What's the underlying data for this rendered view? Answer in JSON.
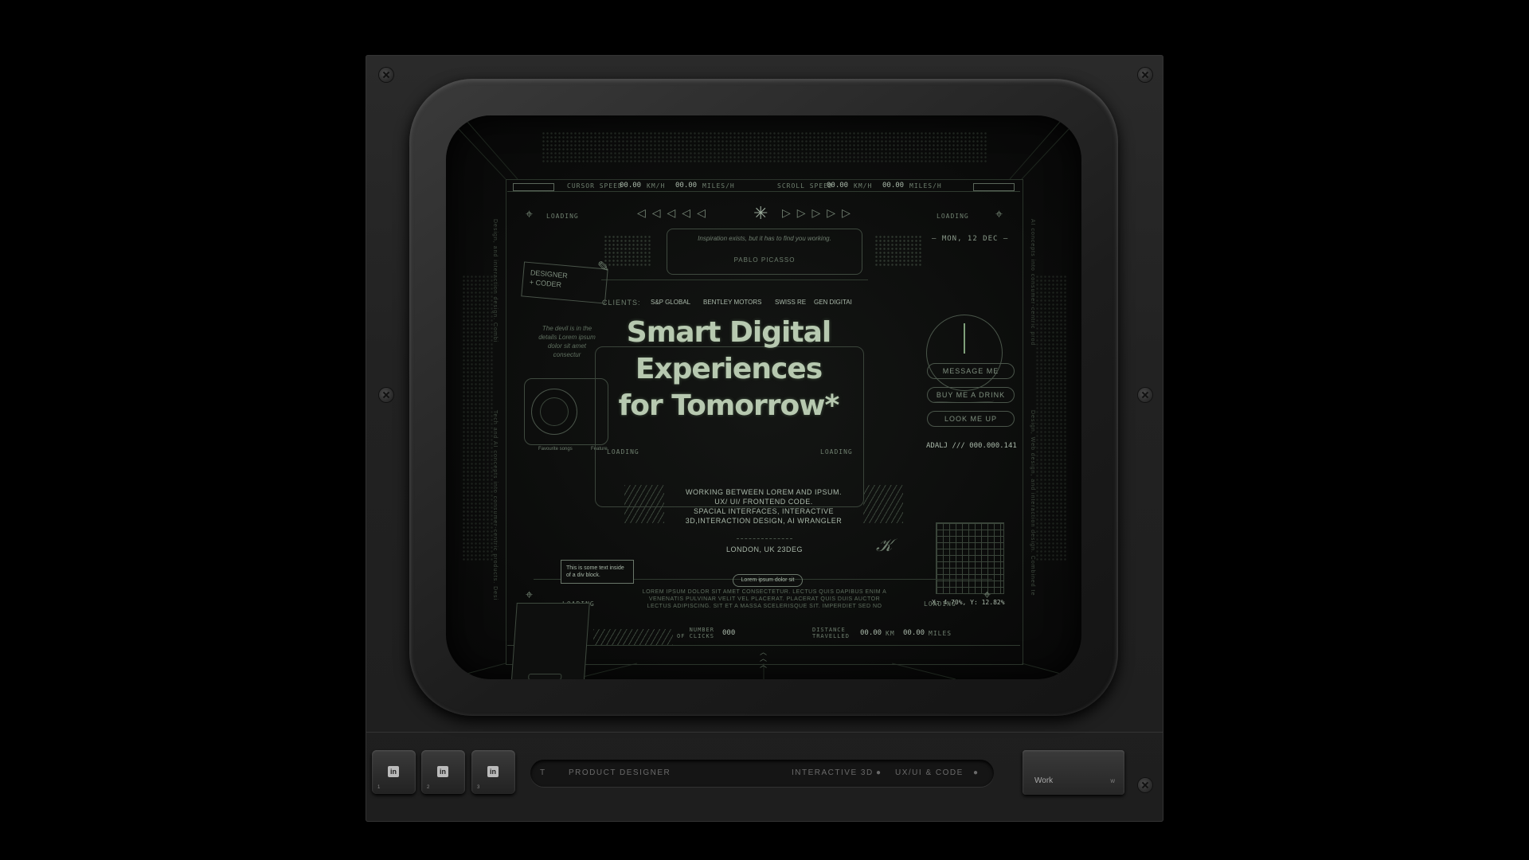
{
  "hud": {
    "cursor_speed_label": "CURSOR SPEED",
    "cursor_kmh": "00.00",
    "kmh_unit": "KM/H",
    "cursor_mph": "00.00",
    "mph_unit": "MILES/H",
    "scroll_speed_label": "SCROLL SPEED",
    "scroll_kmh": "00.00",
    "scroll_mph": "00.00",
    "loading": "LOADING",
    "quote": "Inspiration exists, but it has to find you working.",
    "quote_author": "PABLO PICASSO",
    "date": "– MON, 12 DEC –",
    "clients_label": "CLIENTS:",
    "clients": [
      "S&P GLOBAL",
      "BENTLEY MOTORS",
      "SWISS RE",
      "GEN DIGITAI"
    ],
    "tag": "DESIGNER\n+ CODER",
    "devil": "The devil is in the details Lorem ipsum dolor sit amet consectur",
    "favourite_label": "Favourite songs",
    "feature_label": "Feature",
    "message": "MESSAGE ME",
    "drink": "BUY ME A DRINK",
    "look": "LOOK ME UP",
    "adalj": "ADALJ /// 000.000.141",
    "coords": "X: 4.70%, Y: 12.82%",
    "tooltip": "This is some text inside of a div block.",
    "working": "WORKING BETWEEN LOREM AND IPSUM.\nUX/ UI/ FRONTEND CODE.\nSPACIAL INTERFACES, INTERACTIVE\n3D,INTERACTION DESIGN, AI WRANGLER",
    "location": "LONDON, UK 23DEG",
    "lorem_btn": "Lorem ipsum dolor sit",
    "lorem_body": "LOREM IPSUM DOLOR SIT AMET CONSECTETUR. LECTUS QUIS DAPIBUS ENIM A VENENATIS PULVINAR VELIT VEL PLACERAT. PLACERAT QUIS DUIS AUCTOR LECTUS ADIPISCING. SIT ET A MASSA SCELERISQUE SIT. IMPERDIET SED NO",
    "clicks_label": "NUMBER\nOF CLICKS",
    "clicks": "000",
    "distance_label": "DISTANCE\nTRAVELLED",
    "distance_km": "00.00",
    "km_unit": "KM",
    "distance_mi": "00.00",
    "miles_unit": "MILES",
    "side_text_left": "Design, and interaction design. Combi",
    "side_text_left2": "Tech and AI concepts into consumer-centric products. Desi",
    "side_text_right": "AI concepts into consumer-centric prod",
    "side_text_right2": "Design, Web design, and interaction design. Combined te"
  },
  "hero": {
    "line1": "Smart Digital",
    "line2": "Experiences",
    "line3": "for Tomorrow*"
  },
  "bottom": {
    "keys": [
      {
        "icon": "in",
        "num": "1"
      },
      {
        "icon": "in",
        "num": "2"
      },
      {
        "icon": "in",
        "num": "3"
      }
    ],
    "ticker_t": "T",
    "ticker_1": "PRODUCT DESIGNER",
    "ticker_2": "INTERACTIVE 3D",
    "ticker_3": "UX/UI & CODE",
    "work_label": "Work",
    "work_key": "W"
  },
  "colors": {
    "accent": "#b7c9b0",
    "body": "#1e1e1e"
  }
}
